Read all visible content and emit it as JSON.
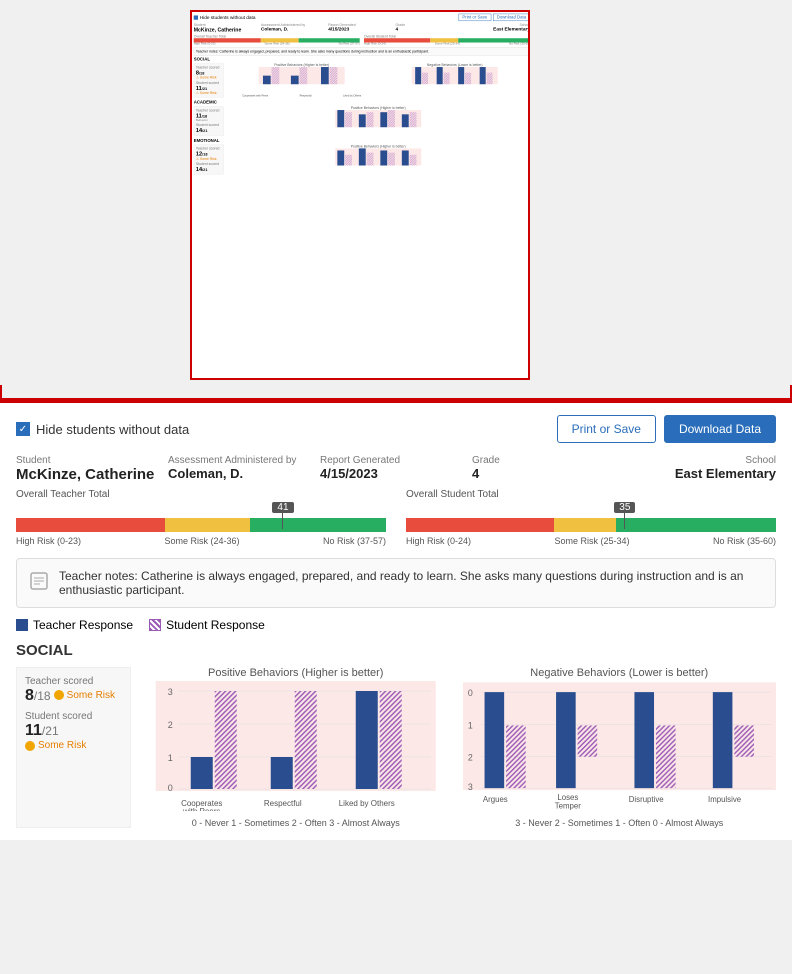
{
  "preview": {
    "visible": true
  },
  "controls": {
    "hide_students_label": "Hide students without data",
    "print_save_label": "Print or Save",
    "download_data_label": "Download Data"
  },
  "student_info": {
    "student_label": "Student",
    "student_name": "McKinze, Catherine",
    "assessed_by_label": "Assessment Administered by",
    "assessed_by": "Coleman, D.",
    "report_generated_label": "Report Generated",
    "report_generated": "4/15/2023",
    "grade_label": "Grade",
    "grade": "4",
    "school_label": "School",
    "school": "East Elementary"
  },
  "overall_teacher_total": {
    "label": "Overall Teacher Total",
    "marker": "41",
    "high_risk": "High Risk (0-23)",
    "some_risk": "Some Risk (24-36)",
    "no_risk": "No Risk (37-57)"
  },
  "overall_student_total": {
    "label": "Overall Student Total",
    "marker": "35",
    "high_risk": "High Risk (0-24)",
    "some_risk": "Some Risk (25-34)",
    "no_risk": "No Risk (35-60)"
  },
  "teacher_notes": {
    "text": "Teacher notes: Catherine is always engaged, prepared, and ready to learn. She asks many questions during instruction and is an enthusiastic participant."
  },
  "legend": {
    "teacher_response": "Teacher Response",
    "student_response": "Student Response"
  },
  "social": {
    "section_label": "SOCIAL",
    "teacher_scored_label": "Teacher scored",
    "teacher_score": "8",
    "teacher_denom": "18",
    "teacher_risk": "Some Risk",
    "student_scored_label": "Student scored",
    "student_score": "11",
    "student_denom": "21",
    "student_risk": "Some Risk",
    "positive_chart_title": "Positive Behaviors (Higher is better)",
    "negative_chart_title": "Negative Behaviors (Lower is better)",
    "positive_categories": [
      "Cooperates with Peers",
      "Respectful",
      "Liked by Others"
    ],
    "negative_categories": [
      "Argues",
      "Loses Temper",
      "Disruptive",
      "Impulsive"
    ],
    "positive_teacher_values": [
      1,
      1,
      3
    ],
    "positive_student_values": [
      3,
      3,
      3
    ],
    "negative_teacher_values": [
      0,
      0,
      0,
      0
    ],
    "negative_student_values": [
      2,
      1,
      2,
      1
    ],
    "chart_legend_positive": "0 - Never   1 - Sometimes   2 - Often   3 - Almost Always",
    "chart_legend_negative": "3 - Never   2 - Sometimes   1 - Often   0 - Almost Always"
  }
}
